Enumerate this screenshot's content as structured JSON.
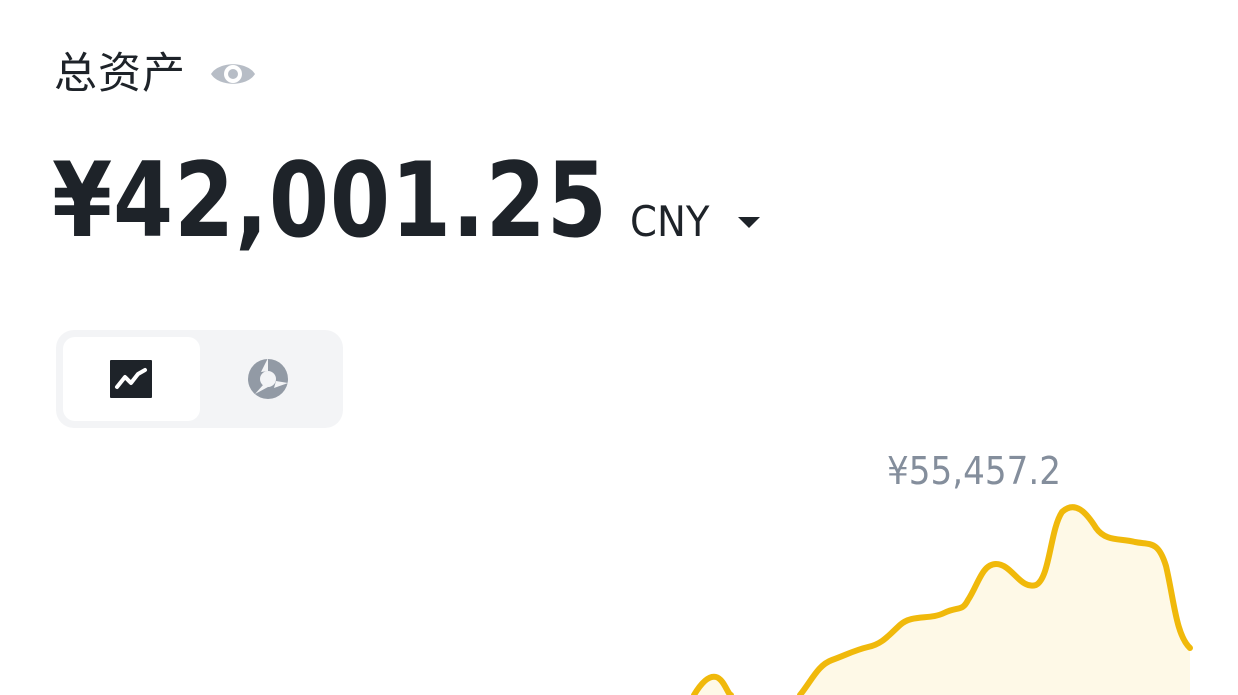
{
  "header": {
    "title": "总资产",
    "visibility_icon": "eye-icon"
  },
  "balance": {
    "value": "¥42,001.25",
    "currency": "CNY",
    "currency_icon": "caret-down-icon"
  },
  "view_toggle": {
    "options": [
      {
        "name": "line-chart",
        "icon": "line-chart-icon",
        "selected": true
      },
      {
        "name": "pie-chart",
        "icon": "pie-chart-icon",
        "selected": false
      }
    ]
  },
  "chart": {
    "peak_label": "¥55,457.2",
    "line_color": "#f0b90b",
    "fill_color": "#fef9e7"
  }
}
